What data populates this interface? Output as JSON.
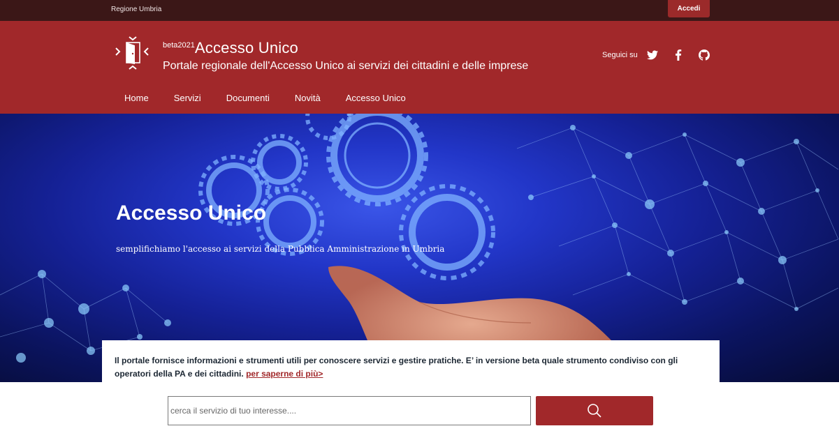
{
  "topbar": {
    "region_label": "Regione Umbria",
    "login_label": "Accedi"
  },
  "header": {
    "beta_label": "beta2021",
    "title": "Accesso Unico",
    "subtitle": "Portale regionale dell'Accesso Unico ai servizi dei cittadini e delle imprese",
    "follow_label": "Seguici su",
    "social_icons": [
      "twitter-icon",
      "facebook-icon",
      "github-icon"
    ],
    "nav": [
      "Home",
      "Servizi",
      "Documenti",
      "Novità",
      "Accesso Unico"
    ]
  },
  "hero": {
    "title": "Accesso Unico",
    "subtitle": "semplifichiamo l'accesso ai servizi della Pubblica Amministrazione in Umbria"
  },
  "card": {
    "info_text": "Il portale fornisce informazioni e strumenti utili per conoscere servizi e gestire pratiche. E’ in versione beta quale strumento condiviso con gli operatori della PA e dei cittadini.",
    "more_link": "per saperne di più>",
    "search_placeholder": "cerca il servizio di tuo interesse....",
    "search_icon": "search-icon"
  },
  "colors": {
    "brand": "#a1282a",
    "topbar": "#3b1717"
  }
}
